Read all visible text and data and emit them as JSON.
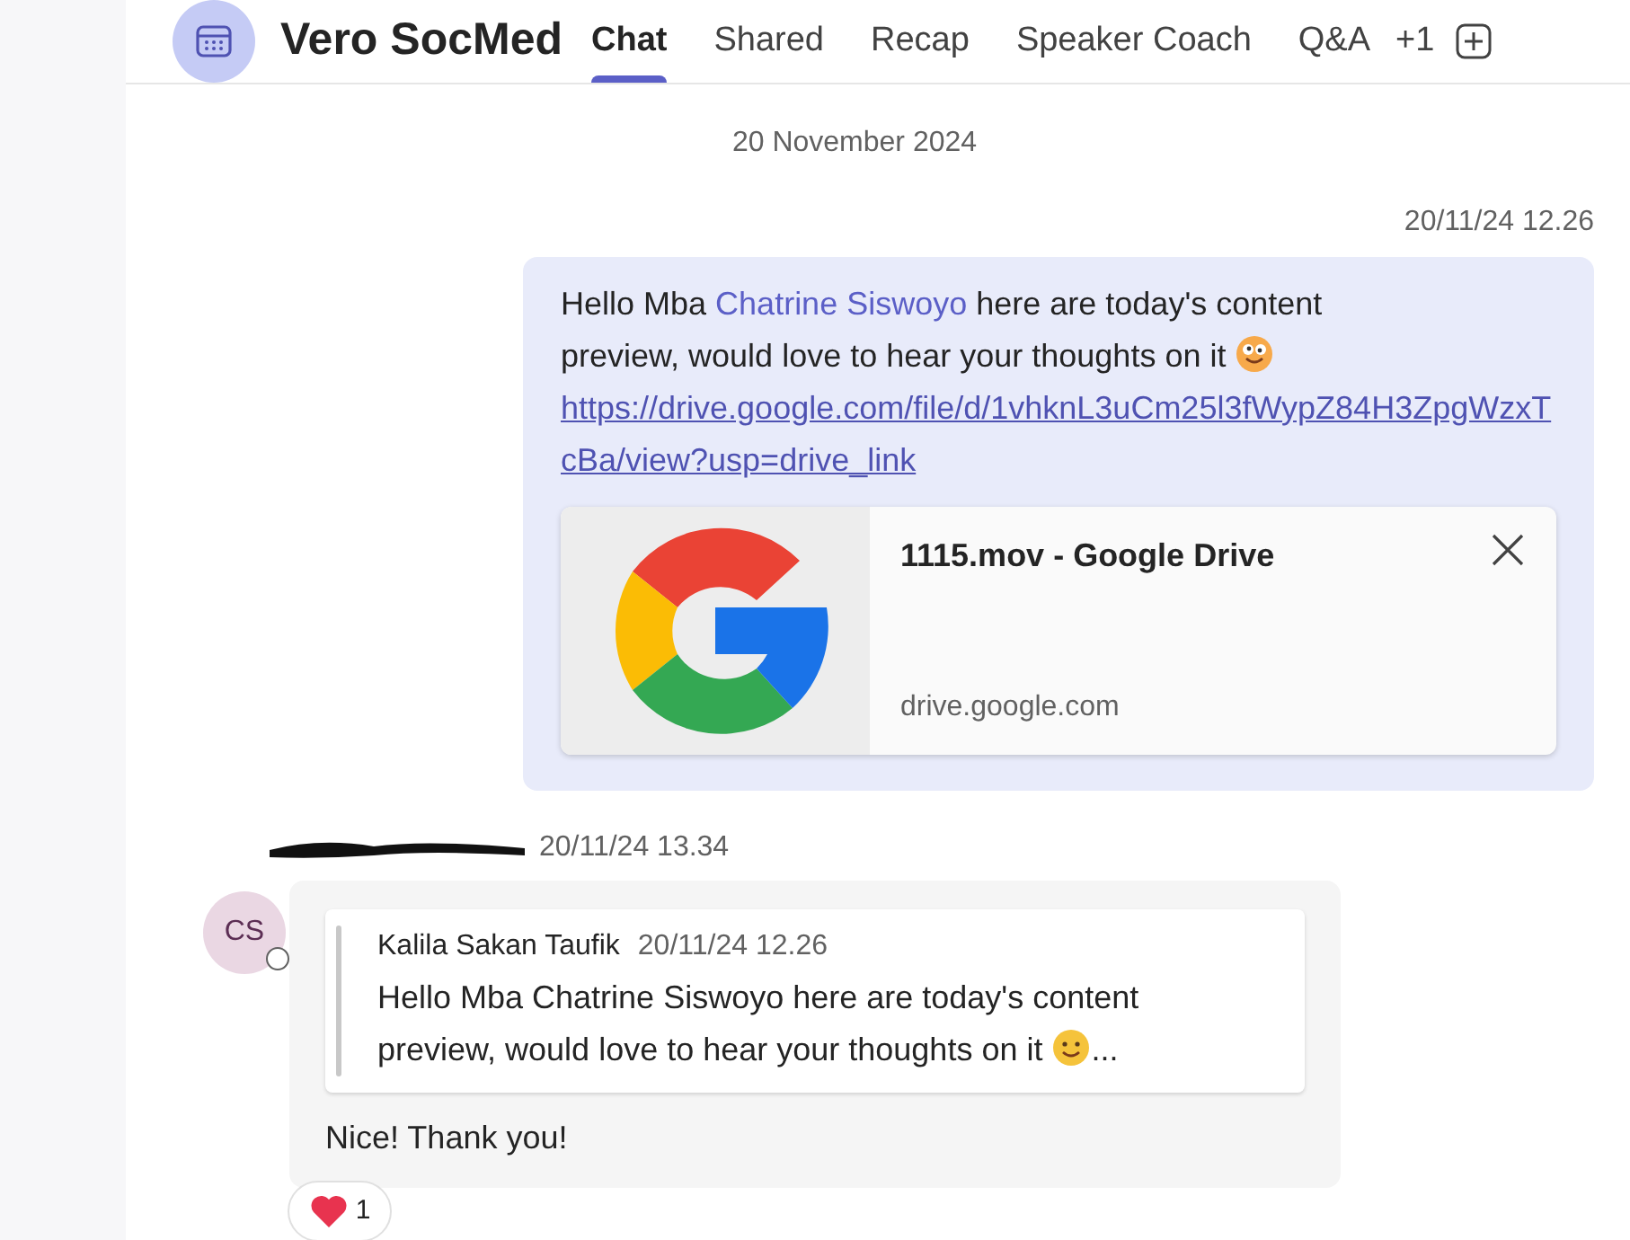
{
  "header": {
    "title": "Vero SocMed",
    "tabs": [
      {
        "label": "Chat",
        "selected": true
      },
      {
        "label": "Shared",
        "selected": false
      },
      {
        "label": "Recap",
        "selected": false
      },
      {
        "label": "Speaker Coach",
        "selected": false
      },
      {
        "label": "Q&A",
        "selected": false
      }
    ],
    "more": "+1"
  },
  "date_divider": "20 November 2024",
  "sent_message": {
    "time": "20/11/24 12.26",
    "text_before": "Hello Mba ",
    "mention": "Chatrine Siswoyo",
    "text_after": " here are today's content preview, would love to hear your thoughts on it",
    "link": "https://drive.google.com/file/d/1vhknL3uCm25l3fWypZ84H3ZpgWzxTcBa/view?usp=drive_link",
    "preview": {
      "title": "1115.mov - Google Drive",
      "domain": "drive.google.com"
    }
  },
  "received_message": {
    "time": "20/11/24 13.34",
    "avatar": "CS",
    "quote": {
      "author": "Kalila Sakan Taufik",
      "time": "20/11/24 12.26",
      "text": "Hello Mba Chatrine Siswoyo here are today's content preview, would love to hear your thoughts on it",
      "ellipsis": "..."
    },
    "text": "Nice! Thank you!",
    "reaction_count": "1"
  }
}
